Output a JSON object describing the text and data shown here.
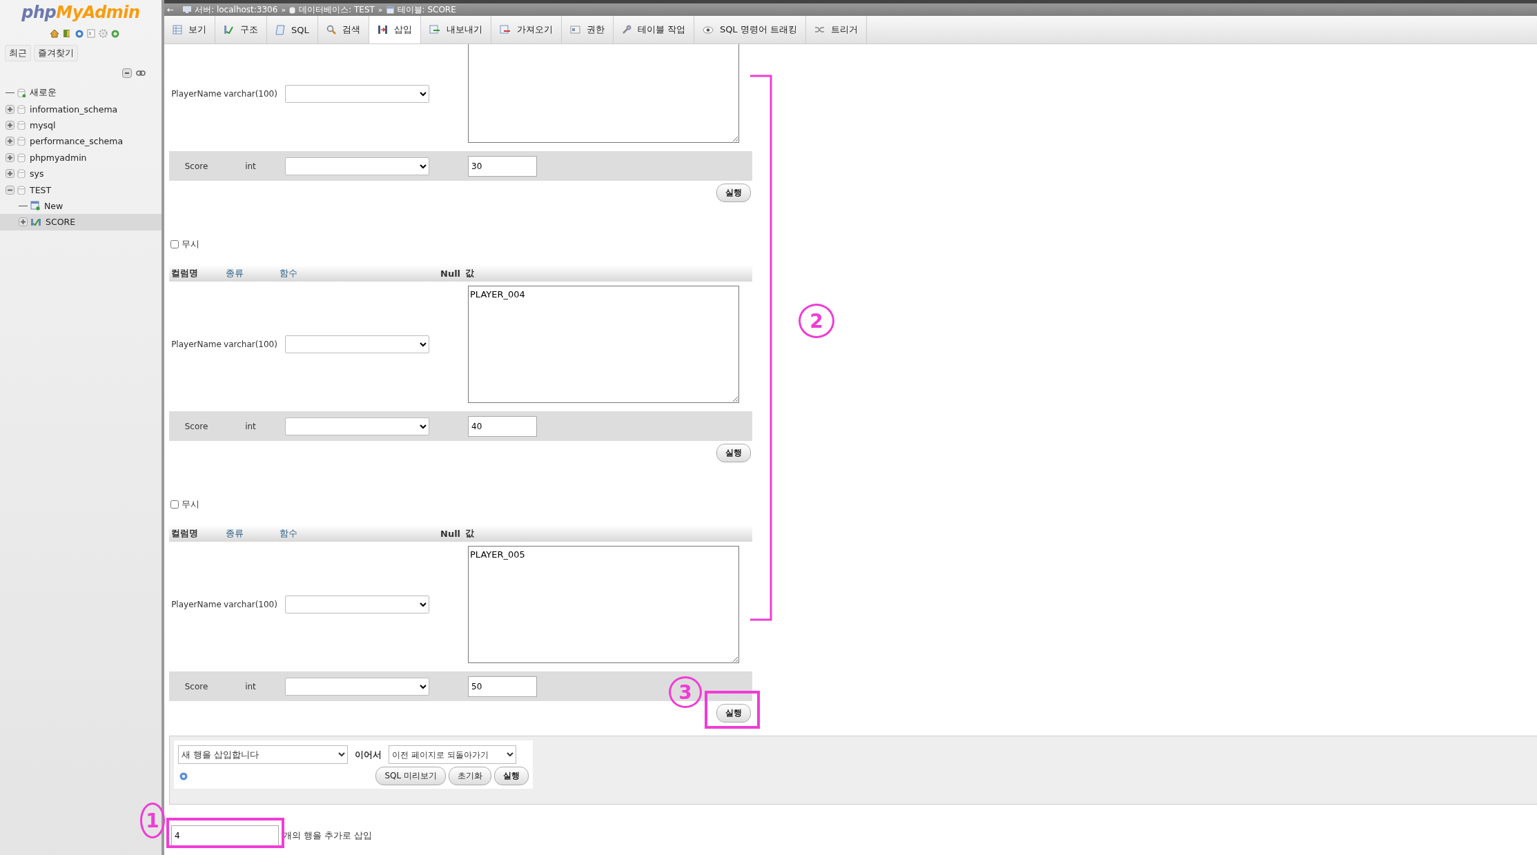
{
  "sidebar": {
    "logo": {
      "prefix": "php",
      "main": "MyAdmin"
    },
    "quick_tabs": [
      "최근",
      "즐겨찾기"
    ],
    "tree": [
      {
        "label": "새로운",
        "kind": "new",
        "selected": false
      },
      {
        "label": "information_schema",
        "kind": "database",
        "expanded": false,
        "selected": false
      },
      {
        "label": "mysql",
        "kind": "database",
        "expanded": false,
        "selected": false
      },
      {
        "label": "performance_schema",
        "kind": "database",
        "expanded": false,
        "selected": false
      },
      {
        "label": "phpmyadmin",
        "kind": "database",
        "expanded": false,
        "selected": false
      },
      {
        "label": "sys",
        "kind": "database",
        "expanded": false,
        "selected": false
      },
      {
        "label": "TEST",
        "kind": "database",
        "expanded": true,
        "selected": false,
        "children": [
          {
            "label": "New",
            "kind": "new_table",
            "selected": false
          },
          {
            "label": "SCORE",
            "kind": "table",
            "expanded": false,
            "selected": true
          }
        ]
      }
    ]
  },
  "breadcrumb": {
    "back": "←",
    "separator": "»",
    "items": [
      {
        "label": "서버: localhost:3306",
        "kind": "server"
      },
      {
        "label": "데이터베이스: TEST",
        "kind": "database"
      },
      {
        "label": "테이블: SCORE",
        "kind": "table"
      }
    ]
  },
  "tabs": [
    {
      "label": "보기",
      "selected": false
    },
    {
      "label": "구조",
      "selected": false
    },
    {
      "label": "SQL",
      "selected": false
    },
    {
      "label": "검색",
      "selected": false
    },
    {
      "label": "삽입",
      "selected": true
    },
    {
      "label": "내보내기",
      "selected": false
    },
    {
      "label": "가져오기",
      "selected": false
    },
    {
      "label": "권한",
      "selected": false
    },
    {
      "label": "테이블 작업",
      "selected": false
    },
    {
      "label": "SQL 명령어 트래킹",
      "selected": false
    },
    {
      "label": "트리거",
      "selected": false
    }
  ],
  "insert_groups": [
    {
      "rows": [
        {
          "column": "PlayerName",
          "type": "varchar(100)",
          "kind": "textarea"
        },
        {
          "column": "Score",
          "type": "int",
          "kind": "input",
          "value": "30"
        }
      ],
      "button": "실행"
    },
    {
      "ignore": {
        "label": "무시",
        "checked": false
      },
      "headers": [
        {
          "label": "컬럼명",
          "sortable": false
        },
        {
          "label": "종류",
          "sortable": true
        },
        {
          "label": "함수",
          "sortable": true
        },
        {
          "label": "Null",
          "sortable": false
        },
        {
          "label": "값",
          "sortable": false
        }
      ],
      "rows": [
        {
          "column": "PlayerName",
          "type": "varchar(100)",
          "kind": "textarea",
          "value": "PLAYER_004"
        },
        {
          "column": "Score",
          "type": "int",
          "kind": "input",
          "value": "40"
        }
      ],
      "button": "실행"
    },
    {
      "ignore": {
        "label": "무시",
        "checked": false
      },
      "headers": [
        {
          "label": "컬럼명",
          "sortable": false
        },
        {
          "label": "종류",
          "sortable": true
        },
        {
          "label": "함수",
          "sortable": true
        },
        {
          "label": "Null",
          "sortable": false
        },
        {
          "label": "값",
          "sortable": false
        }
      ],
      "rows": [
        {
          "column": "PlayerName",
          "type": "varchar(100)",
          "kind": "textarea",
          "value": "PLAYER_005"
        },
        {
          "column": "Score",
          "type": "int",
          "kind": "input",
          "value": "50"
        }
      ],
      "button": "실행"
    }
  ],
  "bottom_panel": {
    "action_select": "새 행을 삽입합니다",
    "then_label": "이어서",
    "then_select": "이전 페이지로 되돌아가기",
    "buttons": [
      {
        "label": "SQL 미리보기",
        "primary": false
      },
      {
        "label": "초기화",
        "primary": false
      },
      {
        "label": "실행",
        "primary": true
      }
    ]
  },
  "rows_to_add": {
    "value": "4",
    "suffix": "개의 행을 추가로 삽입"
  },
  "annotations": [
    {
      "kind": "bracket"
    },
    {
      "kind": "number",
      "label": "2"
    },
    {
      "kind": "number",
      "label": "3"
    },
    {
      "kind": "box"
    },
    {
      "kind": "number",
      "label": "1"
    },
    {
      "kind": "box"
    }
  ]
}
